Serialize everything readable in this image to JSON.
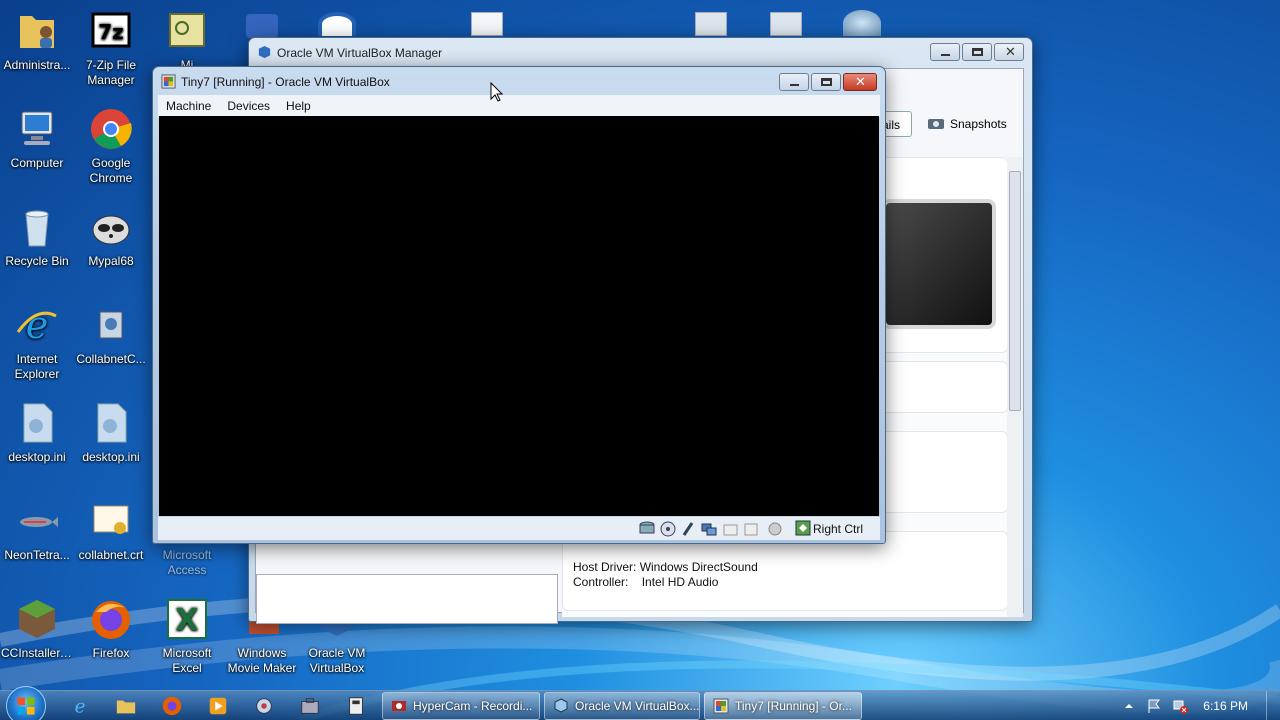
{
  "desktop": {
    "icons": [
      {
        "label": "Administra...",
        "icon": "user-folder-icon"
      },
      {
        "label": "7-Zip File Manager",
        "icon": "7zip-icon"
      },
      {
        "label": "Mi",
        "icon": "microsoft-app-icon"
      },
      {
        "label": "Computer",
        "icon": "computer-icon"
      },
      {
        "label": "Google Chrome",
        "icon": "chrome-icon"
      },
      {
        "label": "Recycle Bin",
        "icon": "recycle-bin-icon"
      },
      {
        "label": "Mypal68",
        "icon": "mypal-icon"
      },
      {
        "label": "Internet Explorer",
        "icon": "ie-icon"
      },
      {
        "label": "CollabnetC...",
        "icon": "collabnet-icon"
      },
      {
        "label": "desktop.ini",
        "icon": "settings-file-icon"
      },
      {
        "label": "desktop.ini",
        "icon": "settings-file-icon"
      },
      {
        "label": "NeonTetra...",
        "icon": "fish-icon"
      },
      {
        "label": "collabnet.crt",
        "icon": "certificate-icon"
      },
      {
        "label": "Microsoft Access",
        "icon": "access-icon"
      },
      {
        "label": "CCInstaller....",
        "icon": "minecraft-icon"
      },
      {
        "label": "Firefox",
        "icon": "firefox-icon"
      },
      {
        "label": "Microsoft Excel",
        "icon": "excel-icon"
      },
      {
        "label": "Windows Movie Maker",
        "icon": "movie-maker-icon"
      },
      {
        "label": "Oracle VM VirtualBox",
        "icon": "virtualbox-icon"
      }
    ]
  },
  "manager": {
    "title": "Oracle VM VirtualBox Manager",
    "tab_details": "ails",
    "tab_snapshots": "Snapshots",
    "audio": {
      "host_driver_label": "Host Driver:",
      "host_driver_value": "Windows DirectSound",
      "controller_label": "Controller:",
      "controller_value": "Intel HD Audio"
    }
  },
  "vm_window": {
    "title": "Tiny7 [Running] - Oracle VM VirtualBox",
    "menu": [
      "Machine",
      "Devices",
      "Help"
    ],
    "host_key": "Right Ctrl"
  },
  "taskbar": {
    "tasks": [
      {
        "label": "HyperCam - Recordi...",
        "icon": "hypercam-icon"
      },
      {
        "label": "Oracle VM VirtualBox...",
        "icon": "virtualbox-icon"
      },
      {
        "label": "Tiny7 [Running] - Or...",
        "icon": "vm-window-icon"
      }
    ],
    "clock": "6:16 PM"
  },
  "colors": {
    "accent": "#1565c0",
    "close": "#c43a22",
    "screen": "#000000"
  }
}
